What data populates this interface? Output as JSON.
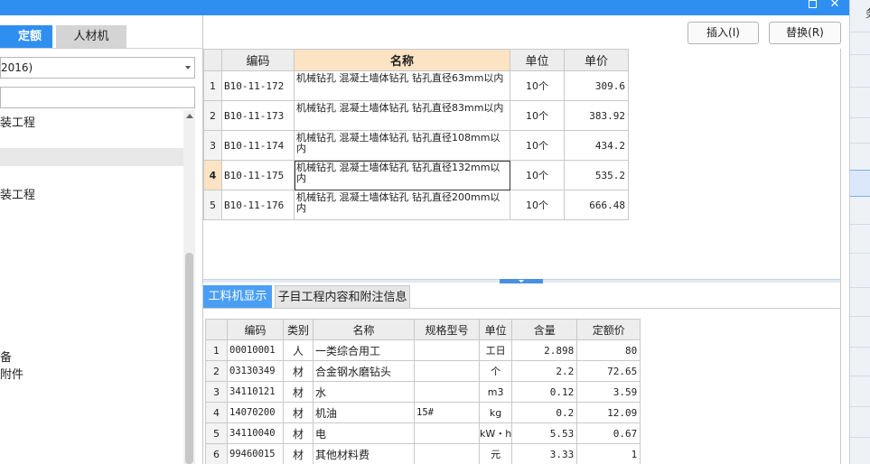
{
  "left_tabs": {
    "quota": "定额",
    "labor": "人材机"
  },
  "library_select": {
    "value": "2016)"
  },
  "tree": {
    "items": [
      "装工程",
      "装工程",
      "备",
      "附件"
    ]
  },
  "toolbar": {
    "insert_label": "插入(I)",
    "replace_label": "替换(R)"
  },
  "right_strip": {
    "cut_text": "务"
  },
  "quota_table": {
    "headers": [
      "编码",
      "名称",
      "单位",
      "单价"
    ],
    "rows": [
      {
        "n": "1",
        "code": "B10-11-172",
        "name": "机械钻孔 混凝土墙体钻孔 钻孔直径63mm以内",
        "unit": "10个",
        "price": "309.6"
      },
      {
        "n": "2",
        "code": "B10-11-173",
        "name": "机械钻孔 混凝土墙体钻孔 钻孔直径83mm以内",
        "unit": "10个",
        "price": "383.92"
      },
      {
        "n": "3",
        "code": "B10-11-174",
        "name": "机械钻孔 混凝土墙体钻孔 钻孔直径108mm以内",
        "unit": "10个",
        "price": "434.2"
      },
      {
        "n": "4",
        "code": "B10-11-175",
        "name": "机械钻孔 混凝土墙体钻孔 钻孔直径132mm以内",
        "unit": "10个",
        "price": "535.2"
      },
      {
        "n": "5",
        "code": "B10-11-176",
        "name": "机械钻孔 混凝土墙体钻孔 钻孔直径200mm以内",
        "unit": "10个",
        "price": "666.48"
      }
    ]
  },
  "bottom_tabs": {
    "labor_display": "工料机显示",
    "sub_info": "子目工程内容和附注信息"
  },
  "material_table": {
    "headers": [
      "编码",
      "类别",
      "名称",
      "规格型号",
      "单位",
      "含量",
      "定额价"
    ],
    "rows": [
      {
        "n": "1",
        "code": "00010001",
        "cat": "人",
        "name": "一类综合用工",
        "spec": "",
        "unit": "工日",
        "qty": "2.898",
        "price": "80"
      },
      {
        "n": "2",
        "code": "03130349",
        "cat": "材",
        "name": "合金钢水磨钻头",
        "spec": "",
        "unit": "个",
        "qty": "2.2",
        "price": "72.65"
      },
      {
        "n": "3",
        "code": "34110121",
        "cat": "材",
        "name": "水",
        "spec": "",
        "unit": "m3",
        "qty": "0.12",
        "price": "3.59"
      },
      {
        "n": "4",
        "code": "14070200",
        "cat": "材",
        "name": "机油",
        "spec": "15#",
        "unit": "kg",
        "qty": "0.2",
        "price": "12.09"
      },
      {
        "n": "5",
        "code": "34110040",
        "cat": "材",
        "name": "电",
        "spec": "",
        "unit": "kW・h",
        "qty": "5.53",
        "price": "0.67"
      },
      {
        "n": "6",
        "code": "99460015",
        "cat": "材",
        "name": "其他材料费",
        "spec": "",
        "unit": "元",
        "qty": "3.33",
        "price": "1"
      }
    ]
  },
  "colors": {
    "accent": "#2f8ff0",
    "header_highlight": "#fbe3c4"
  }
}
